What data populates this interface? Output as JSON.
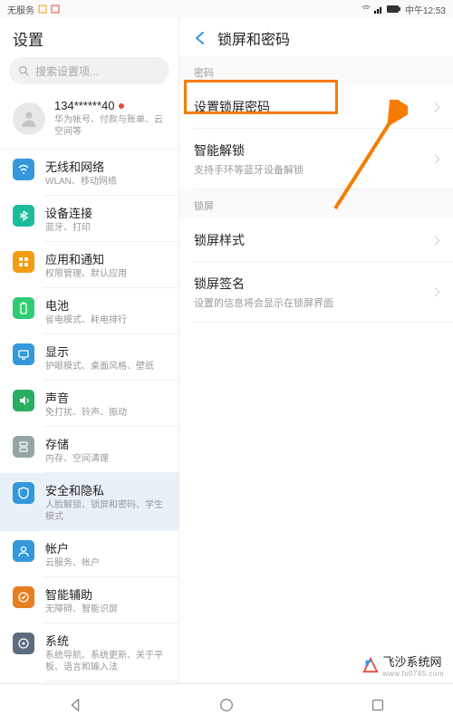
{
  "statusbar": {
    "no_service": "无服务",
    "time": "中午12:53"
  },
  "sidebar": {
    "title": "设置",
    "search_placeholder": "搜索设置项...",
    "account": {
      "phone": "134******40",
      "sub": "华为帐号、付款与账单、云空间等"
    },
    "items": [
      {
        "title": "无线和网络",
        "sub": "WLAN、移动网络",
        "color": "#3498db",
        "icon": "wifi"
      },
      {
        "title": "设备连接",
        "sub": "蓝牙、打印",
        "color": "#1abc9c",
        "icon": "bluetooth"
      },
      {
        "title": "应用和通知",
        "sub": "权限管理、默认应用",
        "color": "#f39c12",
        "icon": "apps"
      },
      {
        "title": "电池",
        "sub": "省电模式、耗电排行",
        "color": "#2ecc71",
        "icon": "battery"
      },
      {
        "title": "显示",
        "sub": "护眼模式、桌面风格、壁纸",
        "color": "#3498db",
        "icon": "display"
      },
      {
        "title": "声音",
        "sub": "免打扰、铃声、振动",
        "color": "#27ae60",
        "icon": "sound"
      },
      {
        "title": "存储",
        "sub": "内存、空间清理",
        "color": "#95a5a6",
        "icon": "storage"
      },
      {
        "title": "安全和隐私",
        "sub": "人脸解锁、锁屏和密码、学生模式",
        "color": "#3498db",
        "icon": "shield",
        "active": true
      },
      {
        "title": "帐户",
        "sub": "云服务、帐户",
        "color": "#3498db",
        "icon": "user"
      },
      {
        "title": "智能辅助",
        "sub": "无障碍、智能识屏",
        "color": "#e67e22",
        "icon": "assist"
      },
      {
        "title": "系统",
        "sub": "系统导航、系统更新、关于平板、语言和输入法",
        "color": "#5d6d7e",
        "icon": "system"
      }
    ]
  },
  "detail": {
    "title": "锁屏和密码",
    "sections": [
      {
        "label": "密码",
        "items": [
          {
            "title": "设置锁屏密码",
            "highlight": true
          },
          {
            "title": "智能解锁",
            "sub": "支持手环等蓝牙设备解锁"
          }
        ]
      },
      {
        "label": "锁屏",
        "items": [
          {
            "title": "锁屏样式"
          },
          {
            "title": "锁屏签名",
            "sub": "设置的信息将会显示在锁屏界面"
          }
        ]
      }
    ]
  },
  "watermark": {
    "main": "飞沙系统网",
    "sub": "www.fs0745.com"
  }
}
